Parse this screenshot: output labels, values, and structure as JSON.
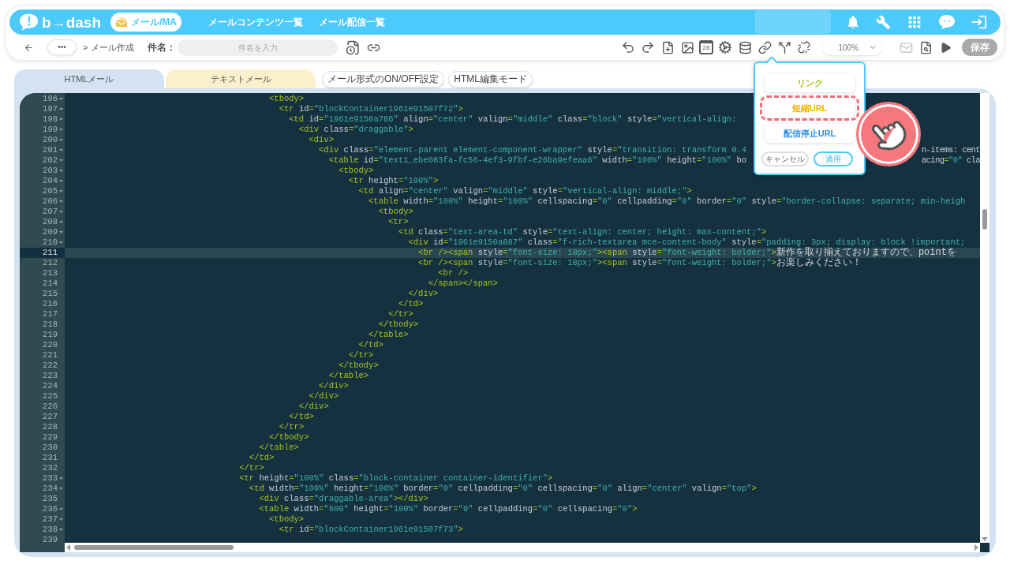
{
  "header": {
    "logo": "b→dash",
    "app_pill": "メール/MA",
    "nav_links": [
      "メールコンテンツ一覧",
      "メール配信一覧"
    ]
  },
  "toolbar": {
    "more": "•••",
    "separator": ">",
    "current": "メール作成",
    "subject_label": "件名：",
    "subject_placeholder": "件名を入力",
    "calendar_day": "28",
    "zoom": "100%",
    "save": {
      "label": "保存",
      "disabled": true
    }
  },
  "tabs": [
    {
      "label": "HTMLメール",
      "selected": true
    },
    {
      "label": "テキストメール",
      "selected": false
    }
  ],
  "mode_buttons": [
    "メール形式のON/OFF設定",
    "HTML編集モード"
  ],
  "editor": {
    "lines": [
      {
        "number": "196",
        "fold": true,
        "active": false,
        "text": "                                        <tbody>"
      },
      {
        "number": "197",
        "fold": true,
        "active": false,
        "text": "                                          <tr id=\"blockContainer1961e91507f72\">"
      },
      {
        "number": "198",
        "fold": true,
        "active": false,
        "text": "                                            <td id=\"1961e9150a786\" align=\"center\" valign=\"middle\" class=\"block\" style=\"vertical-align: "
      },
      {
        "number": "199",
        "fold": true,
        "active": false,
        "text": "                                              <div class=\"draggable\">"
      },
      {
        "number": "200",
        "fold": true,
        "active": false,
        "text": "                                                <div>"
      },
      {
        "number": "201",
        "fold": true,
        "active": false,
        "text": "                                                  <div class=\"element-parent element-component-wrapper\" style=\"transition: transform 0.4",
        "tail": "n-items: cent"
      },
      {
        "number": "202",
        "fold": true,
        "active": false,
        "text": "                                                    <table id=\"text1_ebe083fa-fc56-4ef3-9fbf-e26ba9efeaa6\" width=\"100%\" height=\"100%\" bo",
        "tail": "acing=\"0\" cla"
      },
      {
        "number": "203",
        "fold": true,
        "active": false,
        "text": "                                                      <tbody>"
      },
      {
        "number": "204",
        "fold": true,
        "active": false,
        "text": "                                                        <tr height=\"100%\">"
      },
      {
        "number": "205",
        "fold": true,
        "active": false,
        "text": "                                                          <td align=\"center\" valign=\"middle\" style=\"vertical-align: middle;\">"
      },
      {
        "number": "206",
        "fold": true,
        "active": false,
        "text": "                                                            <table width=\"100%\" height=\"100%\" cellspacing=\"0\" cellpadding=\"0\" border=\"0\" style=\"border-collapse: separate; min-heigh"
      },
      {
        "number": "207",
        "fold": true,
        "active": false,
        "text": "                                                              <tbody>"
      },
      {
        "number": "208",
        "fold": true,
        "active": false,
        "text": "                                                                <tr>"
      },
      {
        "number": "209",
        "fold": true,
        "active": false,
        "text": "                                                                  <td class=\"text-area-td\" style=\"text-align: center; height: max-content;\">"
      },
      {
        "number": "210",
        "fold": true,
        "active": false,
        "text": "                                                                    <div id=\"1961e9150a887\" class=\"f-rich-textarea mce-content-body\" style=\"padding: 3px; display: block !important;"
      },
      {
        "number": "211",
        "fold": false,
        "active": true,
        "text": "                                                                      <br /><span style=\"font-size: 18px;\"><span style=\"font-weight: bolder;\">新作を取り揃えておりますので、pointを"
      },
      {
        "number": "212",
        "fold": false,
        "active": false,
        "text": "                                                                      <br /><span style=\"font-size: 18px;\"><span style=\"font-weight: bolder;\">お楽しみください！"
      },
      {
        "number": "213",
        "fold": false,
        "active": false,
        "text": "                                                                          <br />"
      },
      {
        "number": "214",
        "fold": false,
        "active": false,
        "text": "                                                                        </span></span>"
      },
      {
        "number": "215",
        "fold": false,
        "active": false,
        "text": "                                                                    </div>"
      },
      {
        "number": "216",
        "fold": false,
        "active": false,
        "text": "                                                                  </td>"
      },
      {
        "number": "217",
        "fold": false,
        "active": false,
        "text": "                                                                </tr>"
      },
      {
        "number": "218",
        "fold": false,
        "active": false,
        "text": "                                                              </tbody>"
      },
      {
        "number": "219",
        "fold": false,
        "active": false,
        "text": "                                                            </table>"
      },
      {
        "number": "220",
        "fold": false,
        "active": false,
        "text": "                                                          </td>"
      },
      {
        "number": "221",
        "fold": false,
        "active": false,
        "text": "                                                        </tr>"
      },
      {
        "number": "222",
        "fold": false,
        "active": false,
        "text": "                                                      </tbody>"
      },
      {
        "number": "223",
        "fold": false,
        "active": false,
        "text": "                                                    </table>"
      },
      {
        "number": "224",
        "fold": false,
        "active": false,
        "text": "                                                  </div>"
      },
      {
        "number": "225",
        "fold": false,
        "active": false,
        "text": "                                                </div>"
      },
      {
        "number": "226",
        "fold": false,
        "active": false,
        "text": "                                              </div>"
      },
      {
        "number": "227",
        "fold": false,
        "active": false,
        "text": "                                            </td>"
      },
      {
        "number": "228",
        "fold": false,
        "active": false,
        "text": "                                          </tr>"
      },
      {
        "number": "229",
        "fold": false,
        "active": false,
        "text": "                                        </tbody>"
      },
      {
        "number": "230",
        "fold": false,
        "active": false,
        "text": "                                      </table>"
      },
      {
        "number": "231",
        "fold": false,
        "active": false,
        "text": "                                    </td>"
      },
      {
        "number": "232",
        "fold": false,
        "active": false,
        "text": "                                  </tr>"
      },
      {
        "number": "233",
        "fold": true,
        "active": false,
        "text": "                                  <tr height=\"100%\" class=\"block-container container-identifier\">"
      },
      {
        "number": "234",
        "fold": true,
        "active": false,
        "text": "                                    <td width=\"100%\" height=\"100%\" border=\"0\" cellpadding=\"0\" cellspacing=\"0\" align=\"center\" valign=\"top\">"
      },
      {
        "number": "235",
        "fold": false,
        "active": false,
        "text": "                                      <div class=\"draggable-area\"></div>"
      },
      {
        "number": "236",
        "fold": true,
        "active": false,
        "text": "                                      <table width=\"600\" height=\"100%\" border=\"0\" cellpadding=\"0\" cellspacing=\"0\">"
      },
      {
        "number": "237",
        "fold": true,
        "active": false,
        "text": "                                        <tbody>"
      },
      {
        "number": "238",
        "fold": true,
        "active": false,
        "text": "                                          <tr id=\"blockContainer1961e91507f73\">"
      },
      {
        "number": "239",
        "fold": false,
        "active": false
      }
    ]
  },
  "link_popup": {
    "items": [
      {
        "label": "リンク",
        "color": "#9cc812",
        "highlighted": false
      },
      {
        "label": "短縮URL",
        "color": "#f2b200",
        "highlighted": true
      },
      {
        "label": "配信停止URL",
        "color": "#2f8de4",
        "highlighted": false
      }
    ],
    "cancel": "キャンセル",
    "apply": "適用"
  }
}
